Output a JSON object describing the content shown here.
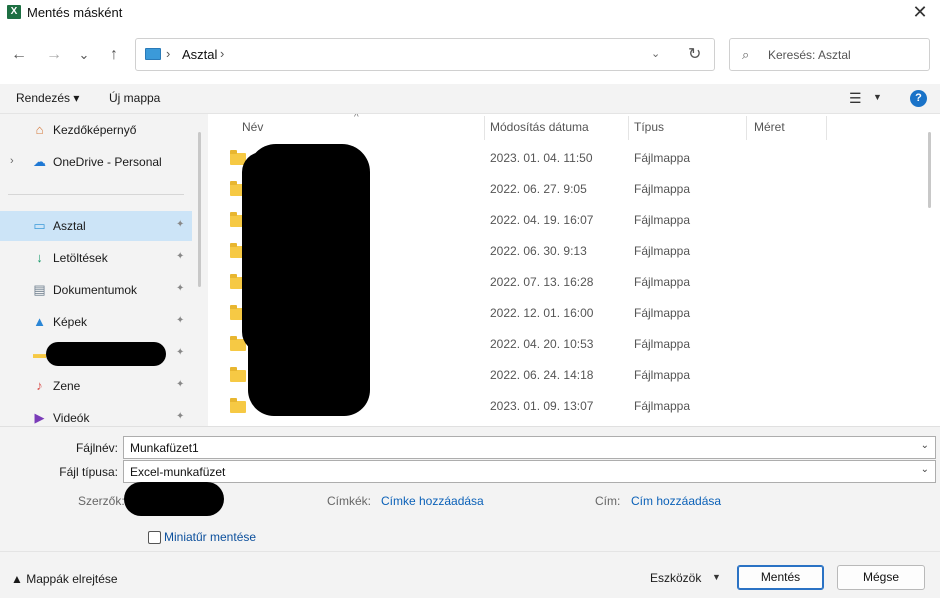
{
  "window": {
    "title": "Mentés másként",
    "app_icon_letter": "X",
    "close": "✕"
  },
  "nav": {
    "back": "←",
    "forward": "→",
    "recent": "⌄",
    "up": "↑",
    "path_sep": "›",
    "current_folder": "Asztal",
    "refresh": "↻",
    "address_dropdown": "⌄",
    "search_placeholder": "Keresés: Asztal",
    "search_icon": "⌕"
  },
  "toolbar": {
    "organize": "Rendezés ▾",
    "new_folder": "Új mappa",
    "view_icon": "☰",
    "view_caret": "▼",
    "help": "?"
  },
  "sidebar": {
    "items": [
      {
        "label": "Kezdőképernyő",
        "icon": "⌂",
        "pinned": false,
        "expand": ""
      },
      {
        "label": "OneDrive - Personal",
        "icon": "☁",
        "pinned": false,
        "expand": "›"
      },
      {
        "label": "Asztal",
        "icon": "▭",
        "pinned": true,
        "expand": "",
        "selected": true
      },
      {
        "label": "Letöltések",
        "icon": "↓",
        "pinned": true,
        "expand": ""
      },
      {
        "label": "Dokumentumok",
        "icon": "▤",
        "pinned": true,
        "expand": ""
      },
      {
        "label": "Képek",
        "icon": "▲",
        "pinned": true,
        "expand": ""
      },
      {
        "label": "",
        "icon": "▬",
        "pinned": true,
        "expand": ""
      },
      {
        "label": "Zene",
        "icon": "♪",
        "pinned": true,
        "expand": ""
      },
      {
        "label": "Videók",
        "icon": "▶",
        "pinned": true,
        "expand": ""
      }
    ],
    "pin_glyph": "✦"
  },
  "columns": {
    "name": "Név",
    "modified": "Módosítás dátuma",
    "type": "Típus",
    "size": "Méret",
    "sort_indicator": "^"
  },
  "files": [
    {
      "modified": "2023. 01. 04. 11:50",
      "type": "Fájlmappa"
    },
    {
      "modified": "2022. 06. 27. 9:05",
      "type": "Fájlmappa"
    },
    {
      "modified": "2022. 04. 19. 16:07",
      "type": "Fájlmappa"
    },
    {
      "modified": "2022. 06. 30. 9:13",
      "type": "Fájlmappa"
    },
    {
      "modified": "2022. 07. 13. 16:28",
      "type": "Fájlmappa"
    },
    {
      "modified": "2022. 12. 01. 16:00",
      "type": "Fájlmappa"
    },
    {
      "modified": "2022. 04. 20. 10:53",
      "type": "Fájlmappa"
    },
    {
      "modified": "2022. 06. 24. 14:18",
      "type": "Fájlmappa"
    },
    {
      "modified": "2023. 01. 09. 13:07",
      "type": "Fájlmappa"
    }
  ],
  "form": {
    "filename_label": "Fájlnév:",
    "filename_value": "Munkafüzet1",
    "filetype_label": "Fájl típusa:",
    "filetype_value": "Excel-munkafüzet",
    "dropdown": "⌄",
    "authors_label": "Szerzők:",
    "tags_label": "Címkék:",
    "tags_link": "Címke hozzáadása",
    "title_label": "Cím:",
    "title_link": "Cím hozzáadása",
    "thumbnail_label": "Miniatűr mentése",
    "thumbnail_checked": false
  },
  "footer": {
    "hide_folders": "▲  Mappák elrejtése",
    "tools": "Eszközök",
    "tools_caret": "▼",
    "save": "Mentés",
    "cancel": "Mégse"
  },
  "colors": {
    "accent": "#1a73c8",
    "selected_bg": "#cce4f7",
    "folder": "#f6c944",
    "link": "#0b61b8",
    "excel": "#1d6f42"
  }
}
